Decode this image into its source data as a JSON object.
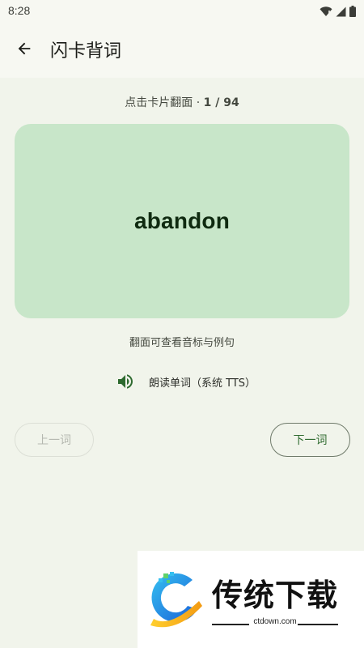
{
  "status_bar": {
    "time": "8:28",
    "icons": [
      "wifi-icon",
      "signal-icon",
      "battery-icon"
    ]
  },
  "app_bar": {
    "title": "闪卡背词",
    "back_icon": "arrow-back-icon"
  },
  "progress": {
    "prefix": "点击卡片翻面 · ",
    "count": "1 / 94"
  },
  "card": {
    "word": "abandon",
    "background": "#c8e6c9"
  },
  "hint": "翻面可查看音标与例句",
  "tts": {
    "icon": "speaker-icon",
    "label": "朗读单词（系统 TTS）"
  },
  "buttons": {
    "prev_label": "上一词",
    "next_label": "下一词"
  },
  "watermark": {
    "title": "传统下载",
    "url": "ctdown.com"
  },
  "colors": {
    "accent": "#2e6a2f",
    "card": "#c8e6c9",
    "background": "#f1f4eb"
  }
}
